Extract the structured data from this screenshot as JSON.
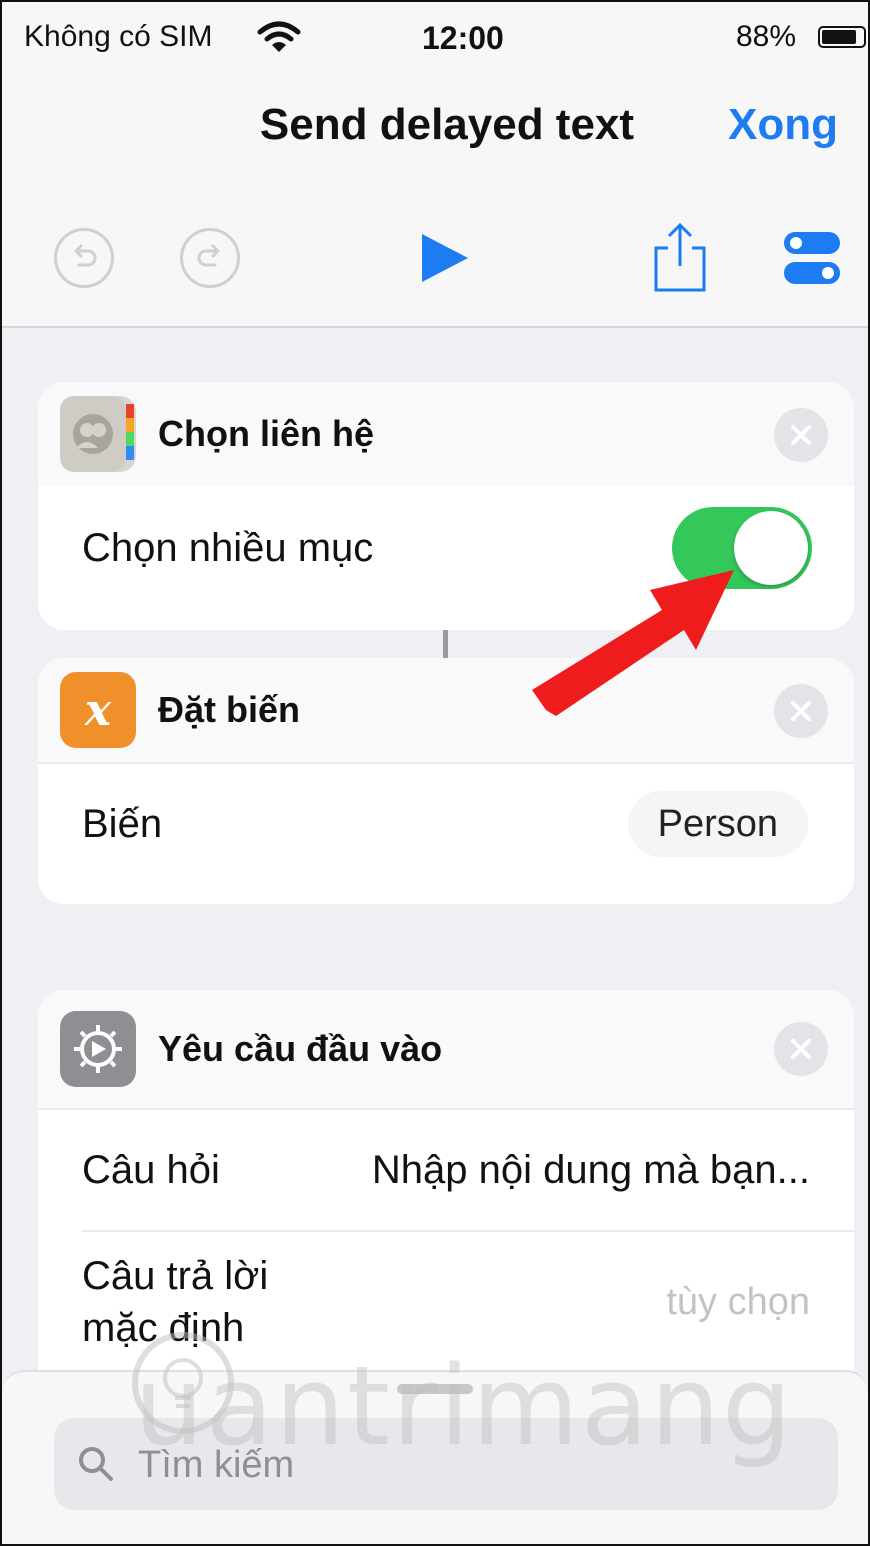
{
  "status_bar": {
    "carrier": "Không có SIM",
    "time": "12:00",
    "battery": "88%"
  },
  "nav": {
    "title": "Send delayed text",
    "done": "Xong"
  },
  "toolbar": [
    "undo-icon",
    "redo-icon",
    "play-icon",
    "share-icon",
    "settings-toggle-icon"
  ],
  "cards": {
    "choose_contacts": {
      "title": "Chọn liên hệ",
      "icon": "contacts-icon",
      "row_label": "Chọn nhiều mục",
      "toggle_on": true
    },
    "set_variable": {
      "title": "Đặt biến",
      "icon": "variable-x-icon",
      "icon_glyph": "x",
      "row_label": "Biến",
      "variable_value": "Person"
    },
    "ask_input": {
      "title": "Yêu cầu đầu vào",
      "icon": "gear-icon",
      "question_label": "Câu hỏi",
      "question_value": "Nhập nội dung mà bạn...",
      "default_label_line1": "Câu trả lời",
      "default_label_line2": "mặc định",
      "default_placeholder": "tùy chọn"
    }
  },
  "search": {
    "placeholder": "Tìm kiếm"
  },
  "watermark": {
    "text": "uantrimang"
  },
  "colors": {
    "accent": "#1e7cf2",
    "toggle_on": "#34c759",
    "variable_icon": "#f0902a",
    "arrow": "#ee1c1c"
  }
}
